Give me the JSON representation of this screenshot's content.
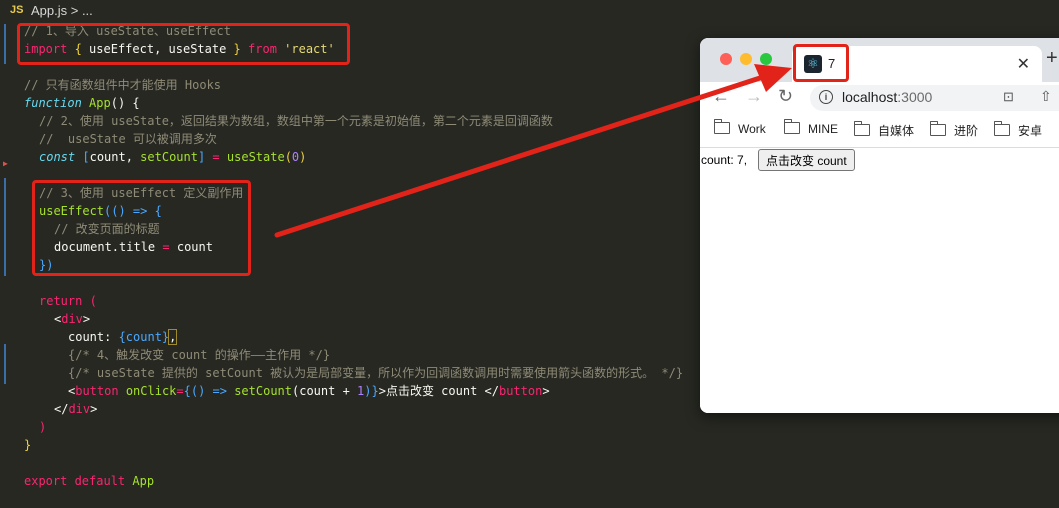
{
  "editor": {
    "tab_badge": "JS",
    "tab_name": "App.js > ...",
    "lines": {
      "l1_comment": "// 1、导入 useState、useEffect",
      "l2_import": "import",
      "l2_open": "{",
      "l2_names": " useEffect, useState ",
      "l2_close": "}",
      "l2_from": "from",
      "l2_src": "'react'",
      "l4_comment": "// 只有函数组件中才能使用 Hooks",
      "l5_function": "function",
      "l5_name": "App",
      "l5_rest": "() {",
      "l6_comment": "// 2、使用 useState，返回结果为数组，数组中第一个元素是初始值，第二个元素是回调函数",
      "l7_comment": "//  useState 可以被调用多次",
      "l8_const": "const",
      "l8_lhs_open": "[",
      "l8_count": "count",
      "l8_comma": ", ",
      "l8_set": "setCount",
      "l8_lhs_close": "]",
      "l8_eq": " = ",
      "l8_call": "useState",
      "l8_paren_open": "(",
      "l8_zero": "0",
      "l8_paren_close": ")",
      "l10_comment": "// 3、使用 useEffect 定义副作用",
      "l11_call": "useEffect",
      "l11_rest": "(() => {",
      "l12_comment": "// 改变页面的标题",
      "l13_lhs": "document.title",
      "l13_eq": " = ",
      "l13_rhs": "count",
      "l14_close": "})",
      "l16_return": "return",
      "l16_paren": " (",
      "l17_lt": "<",
      "l17_tag": "div",
      "l17_gt": ">",
      "l18_text": "count: ",
      "l18_expr": "{count}",
      "l18_comma": ",",
      "l19_comment": "{/* 4、触发改变 count 的操作——主作用 */}",
      "l20_comment": "{/* useState 提供的 setCount 被认为是局部变量，所以作为回调函数调用时需要使用箭头函数的形式。 */}",
      "l21_lt": "<",
      "l21_tag": "button",
      "l21_attr": " onClick",
      "l21_eq": "=",
      "l21_expr_open": "{() => ",
      "l21_call": "setCount",
      "l21_args": "(count + ",
      "l21_one": "1",
      "l21_expr_close": ")}",
      "l21_text": ">点击改变 count </",
      "l21_tag2": "button",
      "l21_gt": ">",
      "l22_lt": "</",
      "l22_tag": "div",
      "l22_gt": ">",
      "l23_paren": ")",
      "l24_brace": "}",
      "l26_export": "export default",
      "l26_name": "App"
    }
  },
  "browser": {
    "tab_title": "7",
    "tab_close": "✕",
    "new_tab": "+",
    "url_host": "localhost",
    "url_port": ":3000",
    "info_icon": "i",
    "bookmarks": [
      "Work",
      "MINE",
      "自媒体",
      "进阶",
      "安卓"
    ],
    "page": {
      "count_text": "count: 7,",
      "button_label": "点击改变 count"
    }
  },
  "colors": {
    "annotation_red": "#e2231a",
    "editor_bg": "#272822",
    "comment": "#8f8b77",
    "keyword": "#f92672",
    "function": "#a6e22e",
    "string": "#e6db74",
    "number": "#ae81ff"
  }
}
